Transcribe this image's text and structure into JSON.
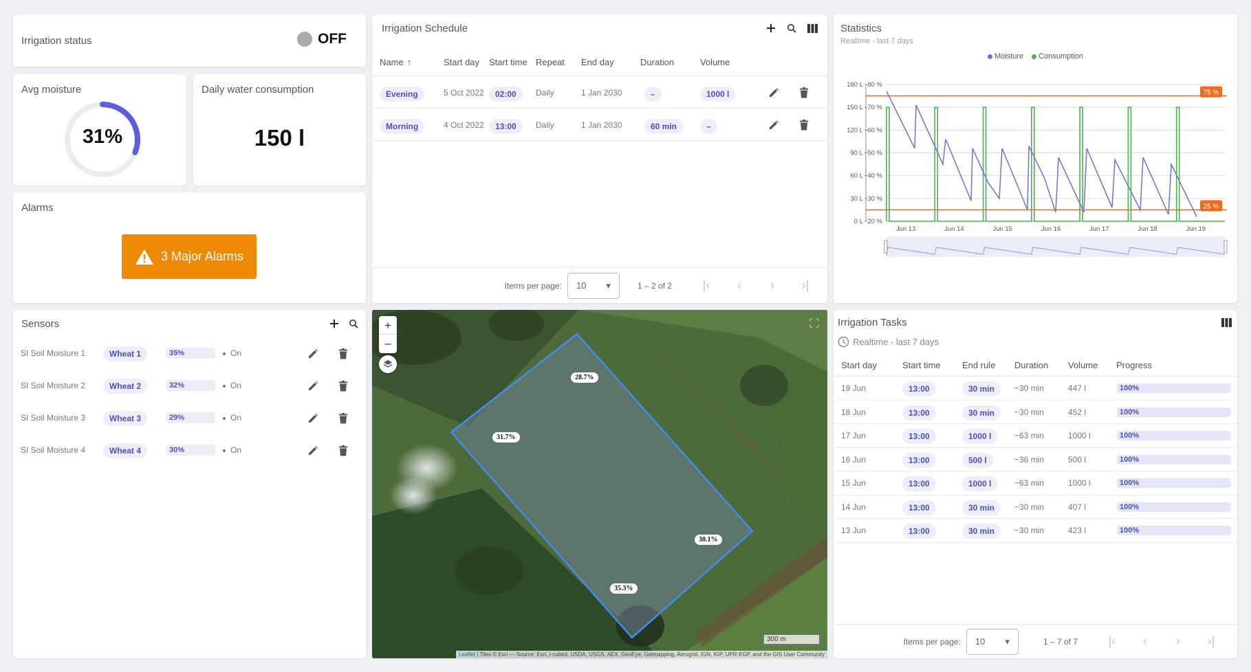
{
  "irrigation_status": {
    "title": "Irrigation status",
    "value": "OFF"
  },
  "avg_moisture": {
    "title": "Avg moisture",
    "value_label": "31%",
    "value": 31
  },
  "daily_water": {
    "title": "Daily water consumption",
    "value": "150 l"
  },
  "alarms": {
    "title": "Alarms",
    "button_label": "3 Major Alarms"
  },
  "schedule": {
    "title": "Irrigation Schedule",
    "columns": [
      "Name",
      "Start day",
      "Start time",
      "Repeat",
      "End day",
      "Duration",
      "Volume"
    ],
    "rows": [
      {
        "name": "Evening",
        "start_day": "5 Oct 2022",
        "start_time": "02:00",
        "repeat": "Daily",
        "end_day": "1 Jan 2030",
        "duration": "–",
        "volume": "1000 l"
      },
      {
        "name": "Morning",
        "start_day": "4 Oct 2022",
        "start_time": "13:00",
        "repeat": "Daily",
        "end_day": "1 Jan 2030",
        "duration": "60 min",
        "volume": "–"
      }
    ],
    "pager": {
      "items_label": "Items per page:",
      "per_page": "10",
      "range": "1 – 2 of 2"
    }
  },
  "statistics": {
    "title": "Statistics",
    "subtitle": "Realtime - last 7 days",
    "legend": [
      "Moisture",
      "Consumption"
    ],
    "colors": {
      "moisture": "#6f6fd8",
      "consumption": "#4caf50",
      "threshold": "#f26b1d"
    },
    "threshold_labels": [
      "75 %",
      "25 %"
    ]
  },
  "chart_data": {
    "type": "line",
    "x": [
      "Jun 13",
      "Jun 14",
      "Jun 15",
      "Jun 16",
      "Jun 17",
      "Jun 18",
      "Jun 19"
    ],
    "ylabel_left_ticks": [
      "180 L",
      "150 L",
      "120 L",
      "90 L",
      "60 L",
      "30 L",
      "0 L"
    ],
    "ylabel_right_ticks": [
      "80 %",
      "70 %",
      "60 %",
      "50 %",
      "40 %",
      "30 %",
      "20 %"
    ],
    "ylim_left": [
      0,
      180
    ],
    "ylim_right": [
      20,
      80
    ],
    "series": [
      {
        "name": "Moisture",
        "axis": "right",
        "points": [
          [
            0,
            77
          ],
          [
            1,
            52
          ],
          [
            1.05,
            71
          ],
          [
            2,
            45
          ],
          [
            2.1,
            56
          ],
          [
            3,
            29
          ],
          [
            3.05,
            52
          ],
          [
            3.6,
            37
          ],
          [
            4,
            30
          ],
          [
            4.1,
            52
          ],
          [
            5,
            25
          ],
          [
            5.05,
            53
          ],
          [
            5.6,
            39
          ],
          [
            6,
            24
          ],
          [
            6.1,
            48
          ],
          [
            7,
            24
          ],
          [
            7.1,
            52
          ],
          [
            8,
            26
          ],
          [
            8.1,
            47
          ],
          [
            9,
            25
          ],
          [
            9.1,
            48
          ],
          [
            10,
            23
          ],
          [
            10.1,
            45
          ],
          [
            11,
            22
          ]
        ]
      },
      {
        "name": "Consumption",
        "axis": "left",
        "pulses_at": [
          "Jun 13",
          "Jun 14",
          "Jun 15",
          "Jun 16",
          "Jun 17",
          "Jun 18",
          "Jun 19"
        ],
        "pulse_value": 150
      }
    ],
    "thresholds": [
      75,
      25
    ],
    "grid": true,
    "legend_position": "top-center"
  },
  "sensors": {
    "title": "Sensors",
    "rows": [
      {
        "name": "SI Soil Moisture 1",
        "crop": "Wheat 1",
        "moisture": "35%",
        "moisture_value": 35,
        "status": "On"
      },
      {
        "name": "SI Soil Moisture 2",
        "crop": "Wheat 2",
        "moisture": "32%",
        "moisture_value": 32,
        "status": "On"
      },
      {
        "name": "SI Soil Moisture 3",
        "crop": "Wheat 3",
        "moisture": "29%",
        "moisture_value": 29,
        "status": "On"
      },
      {
        "name": "SI Soil Moisture 4",
        "crop": "Wheat 4",
        "moisture": "30%",
        "moisture_value": 30,
        "status": "On"
      }
    ]
  },
  "map": {
    "labels": [
      "28.7%",
      "31.7%",
      "30.1%",
      "35.3%"
    ],
    "scale": "300 m",
    "attribution_leaflet": "Leaflet",
    "attribution": " | Tiles © Esri — Source: Esri, i-cubed, USDA, USGS, AEX, GeoEye, Getmapping, Aerogrid, IGN, IGP, UPR-EGP, and the GIS User Community"
  },
  "tasks": {
    "title": "Irrigation Tasks",
    "subtitle": "Realtime - last 7 days",
    "columns": [
      "Start day",
      "Start time",
      "End rule",
      "Duration",
      "Volume",
      "Progress"
    ],
    "rows": [
      {
        "start_day": "19 Jun",
        "start_time": "13:00",
        "end_rule": "30 min",
        "duration": "~30 min",
        "volume": "447 l",
        "progress": "100%"
      },
      {
        "start_day": "18 Jun",
        "start_time": "13:00",
        "end_rule": "30 min",
        "duration": "~30 min",
        "volume": "452 l",
        "progress": "100%"
      },
      {
        "start_day": "17 Jun",
        "start_time": "13:00",
        "end_rule": "1000 l",
        "duration": "~63 min",
        "volume": "1000 l",
        "progress": "100%"
      },
      {
        "start_day": "16 Jun",
        "start_time": "13:00",
        "end_rule": "500 l",
        "duration": "~36 min",
        "volume": "500 l",
        "progress": "100%"
      },
      {
        "start_day": "15 Jun",
        "start_time": "13:00",
        "end_rule": "1000 l",
        "duration": "~63 min",
        "volume": "1000 l",
        "progress": "100%"
      },
      {
        "start_day": "14 Jun",
        "start_time": "13:00",
        "end_rule": "30 min",
        "duration": "~30 min",
        "volume": "407 l",
        "progress": "100%"
      },
      {
        "start_day": "13 Jun",
        "start_time": "13:00",
        "end_rule": "30 min",
        "duration": "~30 min",
        "volume": "423 l",
        "progress": "100%"
      }
    ],
    "pager": {
      "items_label": "Items per page:",
      "per_page": "10",
      "range": "1 – 7 of 7"
    }
  }
}
